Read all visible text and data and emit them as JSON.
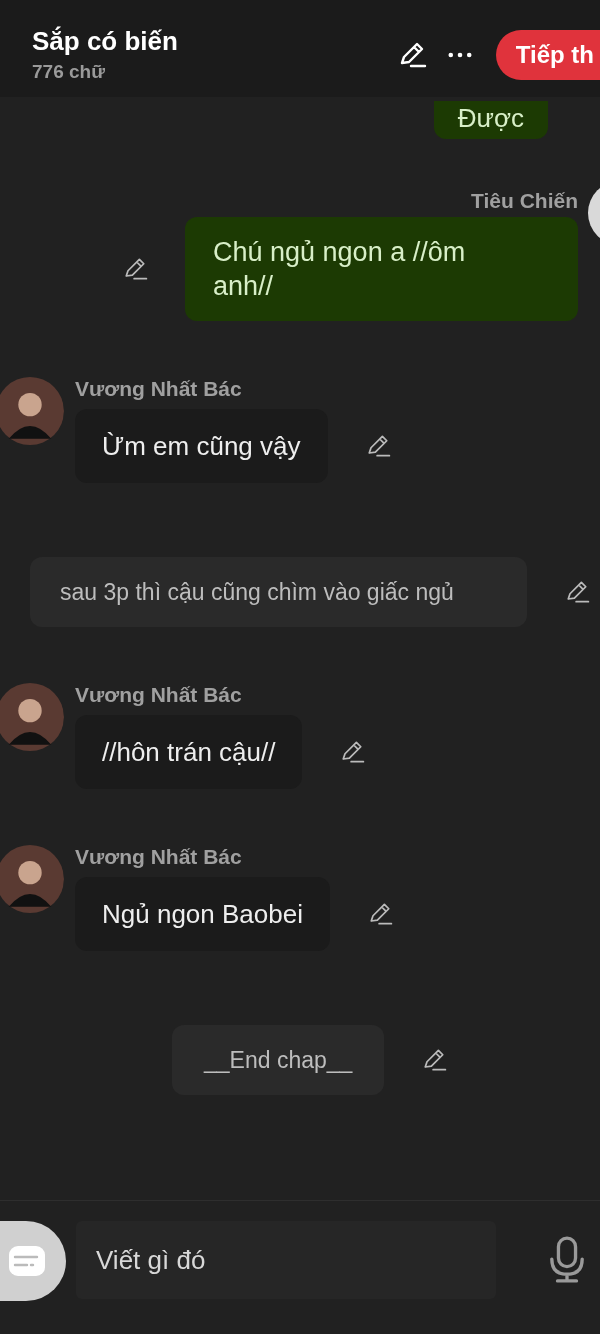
{
  "header": {
    "title": "Sắp có biến",
    "word_count": "776 chữ",
    "next_button": "Tiếp th"
  },
  "messages": [
    {
      "kind": "right",
      "text": "Được",
      "editable": false
    },
    {
      "kind": "right",
      "name": "Tiêu Chiến",
      "text": "Chú ngủ ngon a //ôm anh//",
      "editable": true
    },
    {
      "kind": "left",
      "name": "Vương Nhất Bác",
      "text": "Ừm em cũng vậy",
      "editable": true
    },
    {
      "kind": "narration",
      "text": "sau 3p thì cậu cũng chìm vào giấc ngủ",
      "editable": true
    },
    {
      "kind": "left",
      "name": "Vương Nhất Bác",
      "text": "//hôn trán cậu//",
      "editable": true
    },
    {
      "kind": "left",
      "name": "Vương Nhất Bác",
      "text": "Ngủ ngon Baobei",
      "editable": true
    },
    {
      "kind": "center",
      "text": "__End chap__",
      "editable": true
    }
  ],
  "composer": {
    "placeholder": "Viết gì đó"
  }
}
